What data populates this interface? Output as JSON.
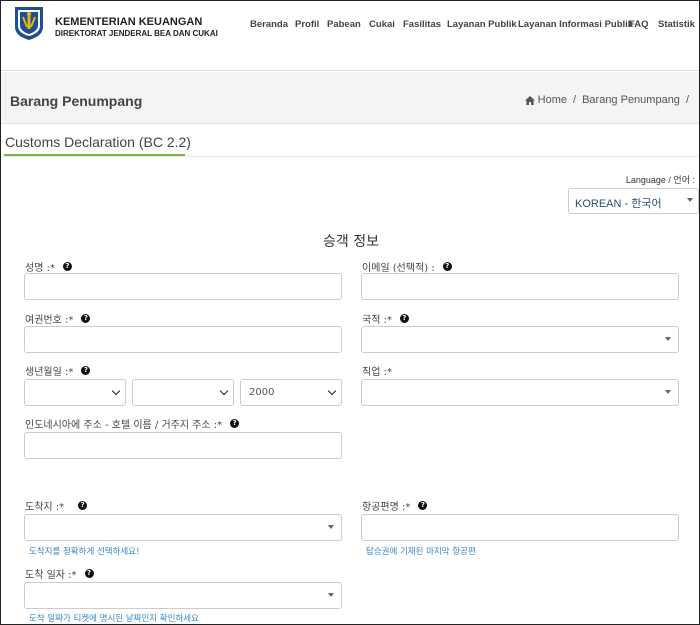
{
  "header": {
    "brand_title": "KEMENTERIAN KEUANGAN",
    "brand_subtitle": "DIREKTORAT JENDERAL BEA DAN CUKAI",
    "nav": [
      "Beranda",
      "Profil",
      "Pabean",
      "Cukai",
      "Fasilitas",
      "Layanan Publik",
      "Layanan Informasi Publik",
      "FAQ",
      "Statistik"
    ]
  },
  "page": {
    "title": "Barang Penumpang",
    "breadcrumb": [
      "Home",
      "Barang Penumpang"
    ]
  },
  "section": {
    "title": "Customs Declaration (BC 2.2)",
    "language_label": "Language / 언어 :",
    "language_value": "KOREAN - 한국어"
  },
  "form": {
    "heading": "승객 정보",
    "name_label": "성명 :*",
    "email_label": "이메일 (선택적) :",
    "passport_label": "여권번호 :*",
    "nationality_label": "국적 :*",
    "dob_label": "생년월일 :*",
    "dob_year_value": "2000",
    "occupation_label": "직업 :*",
    "address_label": "인도네시아에 주소 - 호텔 이름 / 거주지 주소 :*",
    "arrival_place_label": "도착지 :*",
    "arrival_place_hint": "도착지를 정확하게 선택하세요!",
    "flight_label": "항공편명 :*",
    "flight_hint": "탑승권에 기재된 마지막 항공편",
    "arrival_date_label": "도착 일자 :*",
    "arrival_date_hint": "도착 일짜가 티켓에 명시된 날짜인지 확인하세요"
  },
  "colors": {
    "accent_green": "#7ab648",
    "link_blue": "#3a87c8",
    "logo_blue": "#1d4f91",
    "logo_gold": "#e8b21a"
  },
  "icons": {
    "help": "question-circle-icon",
    "home": "home-icon",
    "dropdown": "caret-down-icon"
  }
}
